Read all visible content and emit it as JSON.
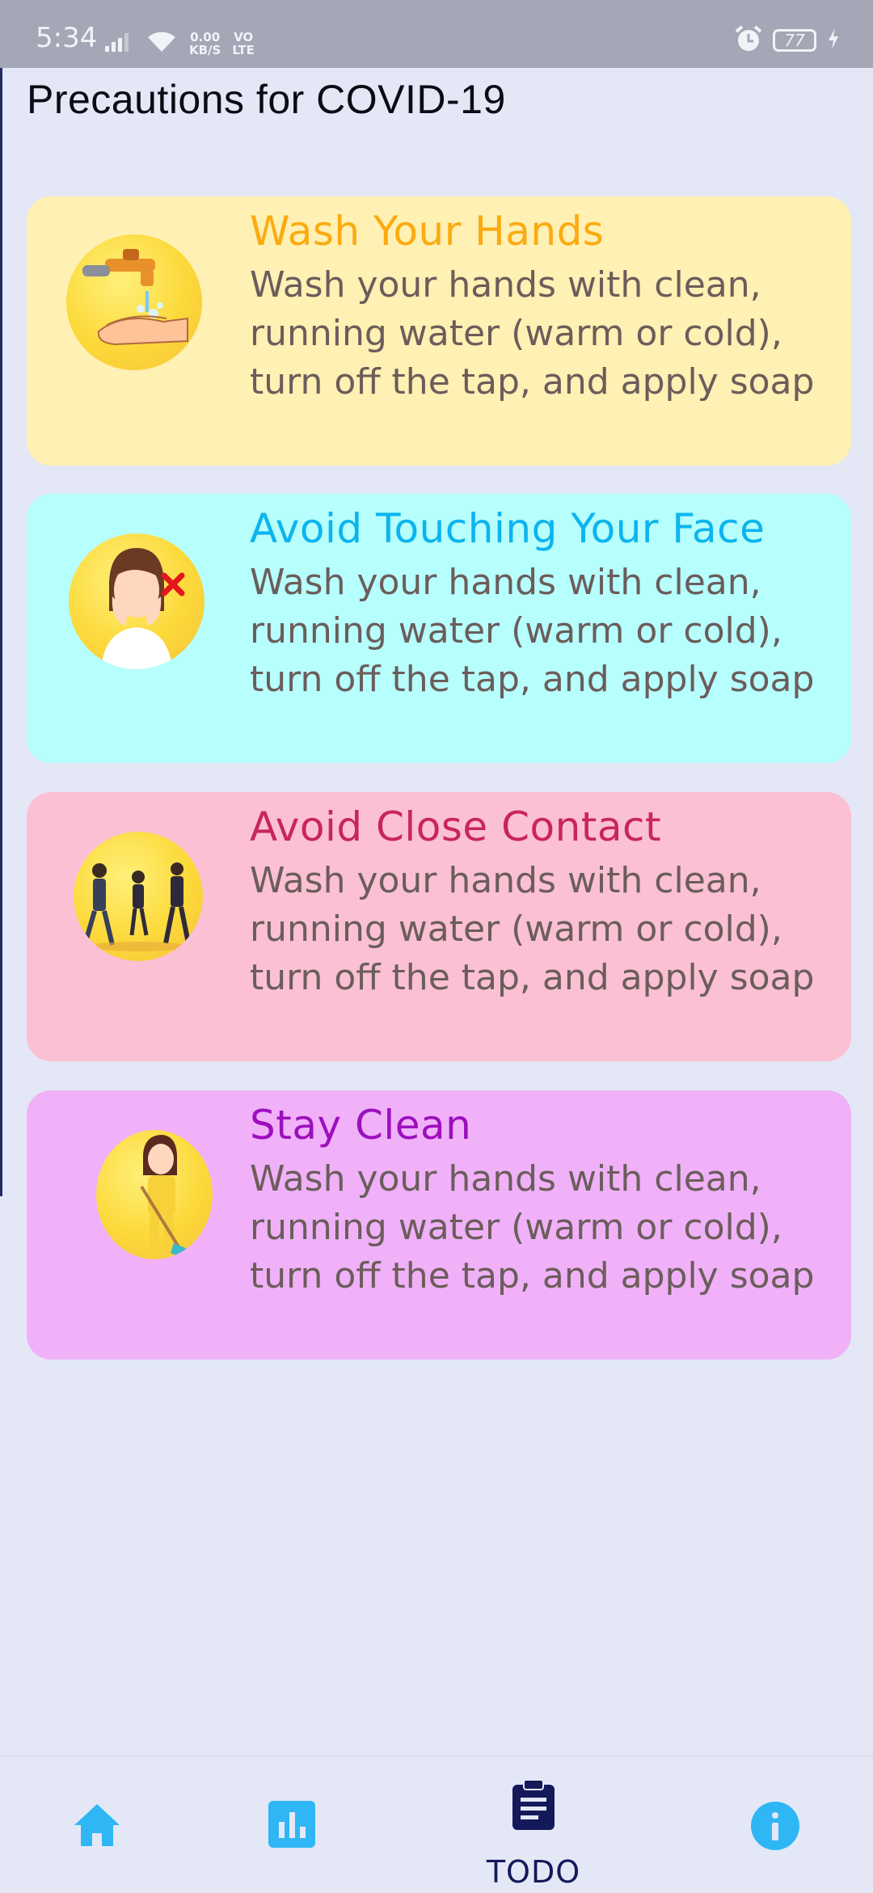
{
  "status_bar": {
    "time": "5:34",
    "net_speed_value": "0.00",
    "net_speed_unit": "KB/S",
    "network_type_top": "VO",
    "network_type_bottom": "LTE",
    "battery_level": "77",
    "icons": [
      "signal-icon",
      "wifi-icon",
      "alarm-icon",
      "battery-icon",
      "charging-icon"
    ]
  },
  "page": {
    "title": "Precautions for COVID-19"
  },
  "cards": [
    {
      "title": "Wash Your Hands",
      "text": "Wash your hands with clean, running water (warm or cold), turn off the tap, and apply soap",
      "background": "#fff0b3",
      "title_color": "#fbaa11",
      "icon": "washing-hands-icon"
    },
    {
      "title": "Avoid Touching Your Face",
      "text": "Wash your hands with clean, running water (warm or cold), turn off the tap, and apply soap",
      "background": "#b6fffd",
      "title_color": "#0cb4ee",
      "icon": "no-face-touching-icon"
    },
    {
      "title": "Avoid Close Contact",
      "text": "Wash your hands with clean, running water (warm or cold), turn off the tap, and apply soap",
      "background": "#fbc0d4",
      "title_color": "#c8255f",
      "icon": "social-distancing-icon"
    },
    {
      "title": "Stay Clean",
      "text": "Wash your hands with clean, running water (warm or cold), turn off the tap, and apply soap",
      "background": "#f0b1f9",
      "title_color": "#9c0fbd",
      "icon": "cleaning-icon"
    }
  ],
  "bottom_nav": {
    "items": [
      {
        "icon": "home-icon",
        "label": ""
      },
      {
        "icon": "stats-icon",
        "label": ""
      },
      {
        "icon": "clipboard-icon",
        "label": "TODO",
        "active": true
      },
      {
        "icon": "info-icon",
        "label": ""
      }
    ],
    "accent_color": "#2fb6f5",
    "active_color": "#14195a"
  }
}
